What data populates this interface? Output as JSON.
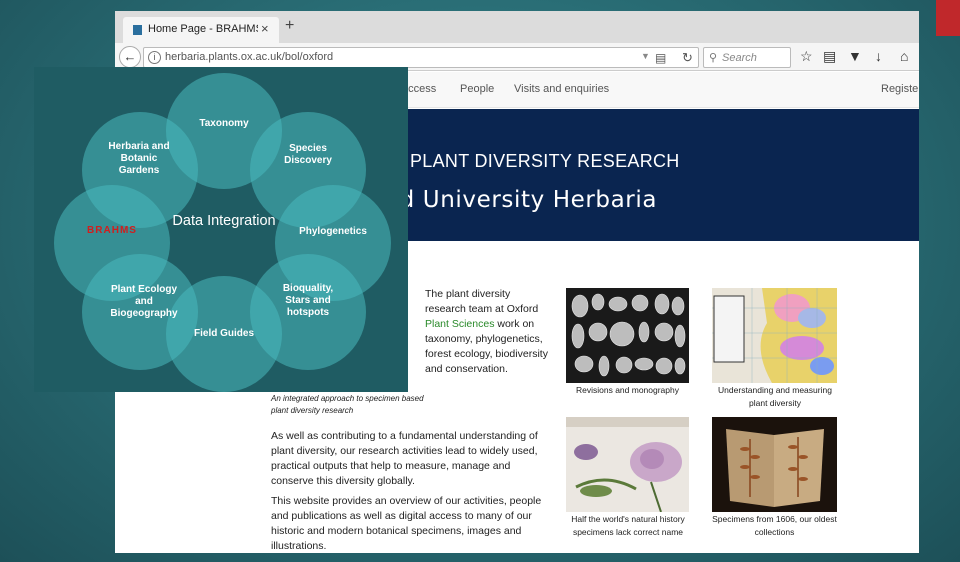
{
  "browser": {
    "tab_title": "Home Page - BRAHMS O...",
    "tab_close": "×",
    "new_tab": "+",
    "url": "herbaria.plants.ox.ac.uk/bol/oxford",
    "search_placeholder": "Search",
    "icons": [
      "back-arrow-icon",
      "info-icon",
      "reader-view-icon",
      "reload-icon",
      "search-icon",
      "bookmark-star-icon",
      "reading-list-icon",
      "pocket-icon",
      "download-icon",
      "home-icon"
    ]
  },
  "site": {
    "nav": {
      "access": "access",
      "people": "People",
      "visits": "Visits and enquiries",
      "register": "Register"
    },
    "banner": {
      "line1": "PLANT DIVERSITY RESEARCH",
      "line2": "rd University Herbaria"
    },
    "intro": {
      "before": "The plant diversity research team at Oxford ",
      "link": "Plant Sciences",
      "after": " work on taxonomy, phylogenetics, forest ecology, biodiversity and conservation."
    },
    "caption_left": "An integrated approach to specimen based plant diversity research",
    "paragraph1": "As well as contributing to a fundamental understanding of plant diversity, our research activities lead to widely used, practical outputs that help to measure, manage and conserve this diversity globally.",
    "paragraph2": "This website provides an overview of our activities, people and publications as well as digital access to many of our historic and modern botanical specimens, images and illustrations.",
    "thumbnails": [
      {
        "caption": "Revisions and monography"
      },
      {
        "caption": "Understanding and measuring plant diversity"
      },
      {
        "caption": "Half the world's natural history specimens lack correct name"
      },
      {
        "caption": "Specimens from 1606, our oldest collections"
      }
    ]
  },
  "diagram": {
    "center": "Data Integration",
    "petals": {
      "taxonomy": "Taxonomy",
      "species": "Species Discovery",
      "phylo": "Phylogenetics",
      "bioquality": "Bioquality, Stars and hotspots",
      "fieldguides": "Field Guides",
      "ecology": "Plant Ecology and Biogeography",
      "brahms": "BRAHMS",
      "herbaria": "Herbaria and Botanic Gardens"
    }
  },
  "colors": {
    "banner": "#0a2550",
    "link": "#2a8a2a",
    "petal": "#48b9be",
    "brahms": "#d11e1e",
    "slide_accent": "#c0282b"
  }
}
